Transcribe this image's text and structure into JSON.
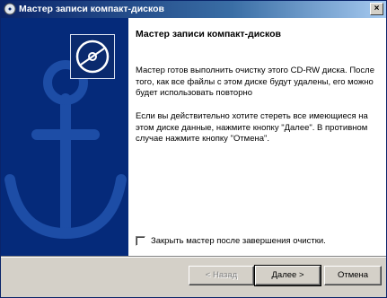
{
  "window": {
    "title": "Мастер записи компакт-дисков",
    "close_label": "×"
  },
  "content": {
    "heading": "Мастер записи компакт-дисков",
    "paragraph1": "Мастер готов выполнить очистку этого CD-RW диска. После того, как все файлы с этом диске будут удалены, его можно будет использовать повторно",
    "paragraph2": "Если вы действительно хотите стереть все имеющиеся на этом диске данные, нажмите кнопку \"Далее\". В противном случае нажмите кнопку \"Отмена\".",
    "checkbox_label": "Закрыть мастер после завершения очистки.",
    "checkbox_checked": false
  },
  "buttons": {
    "back": "< Назад",
    "next": "Далее >",
    "cancel": "Отмена"
  },
  "colors": {
    "banner": "#052a7a",
    "dialog": "#d4d0c8"
  },
  "icons": {
    "app": "cd-wizard-icon",
    "banner": "cd-disc-icon",
    "background": "anchor-icon"
  }
}
